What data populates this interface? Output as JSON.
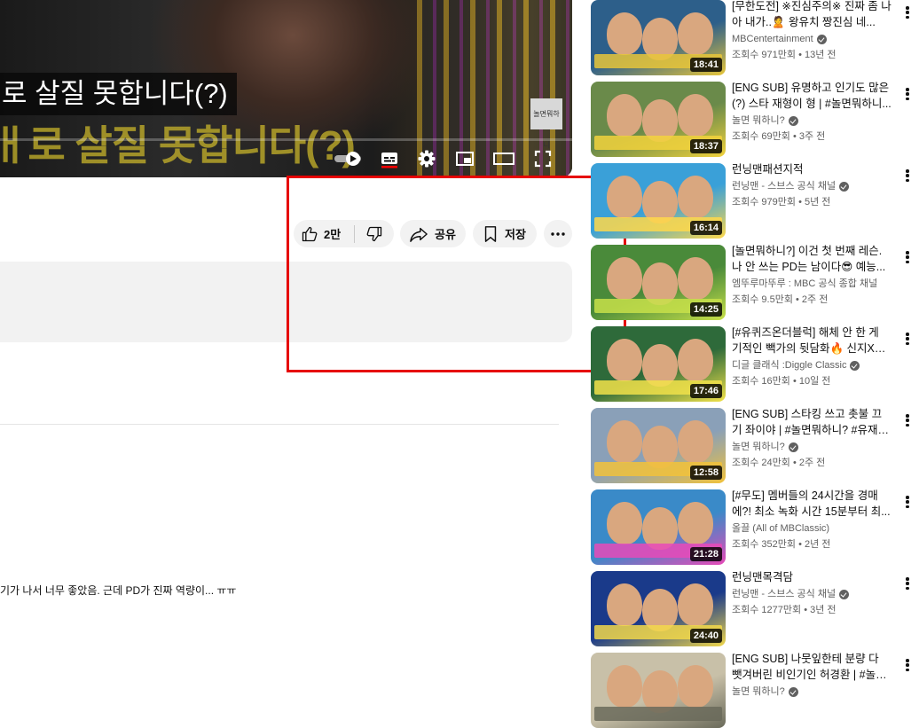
{
  "player": {
    "caption": "로 살질 못합니다(?)",
    "ghost_caption": "ㅐ로 살질 못합니다(?)",
    "watermark": "놀면뭐하니"
  },
  "actions": {
    "like_count": "2만",
    "share_label": "공유",
    "save_label": "저장"
  },
  "comment": {
    "text": "기가 나서 너무 좋았음. 근데 PD가 진짜 역량이... ㅠㅠ"
  },
  "recommendations": [
    {
      "title": "[무한도전] ※진심주의※ 진짜 좀 나아 내가..🙎 왕유치 짱진심 네...",
      "channel": "MBCentertainment",
      "verified": true,
      "views": "조회수 971만회",
      "age": "13년 전",
      "duration": "18:41",
      "thumb_colors": [
        "#2d5f8a",
        "#e8c63a"
      ]
    },
    {
      "title": "[ENG SUB] 유명하고 인기도 많은(?) 스타 재형이 형 | #놀면뭐하니...",
      "channel": "놀면 뭐하니?",
      "verified": true,
      "views": "조회수 69만회",
      "age": "3주 전",
      "duration": "18:37",
      "thumb_colors": [
        "#6a8a4a",
        "#f2d23c"
      ]
    },
    {
      "title": "런닝맨패션지적",
      "channel": "런닝맨 - 스브스 공식 채널",
      "verified": true,
      "views": "조회수 979만회",
      "age": "5년 전",
      "duration": "16:14",
      "thumb_colors": [
        "#3aa0d8",
        "#ffd84a"
      ]
    },
    {
      "title": "[놀면뭐하니?] 이건 첫 번째 레슨. 나 안 쓰는 PD는 남이다😎 예능...",
      "channel": "엠뚜루마뚜루 : MBC 공식 종합 채널",
      "verified": false,
      "views": "조회수 9.5만회",
      "age": "2주 전",
      "duration": "14:25",
      "thumb_colors": [
        "#4a8a3a",
        "#c8e04a"
      ]
    },
    {
      "title": "[#유퀴즈온더블럭] 해체 안 한 게 기적인 빽가의 뒷담화🔥 신지X종민...",
      "channel": "디글 클래식 :Diggle Classic",
      "verified": true,
      "views": "조회수 16만회",
      "age": "10일 전",
      "duration": "17:46",
      "thumb_colors": [
        "#2e6a3a",
        "#f2e24a"
      ]
    },
    {
      "title": "[ENG SUB] 스타킹 쓰고 촛불 끄기 좌이야 | #놀면뭐하니? #유재석 ...",
      "channel": "놀면 뭐하니?",
      "verified": true,
      "views": "조회수 24만회",
      "age": "2주 전",
      "duration": "12:58",
      "thumb_colors": [
        "#8aa0b8",
        "#f2c23a"
      ]
    },
    {
      "title": "[#무도] 멤버들의 24시간을 경매에?! 최소 녹화 시간 15분부터 최...",
      "channel": "올끌 (All of MBClassic)",
      "verified": false,
      "views": "조회수 352만회",
      "age": "2년 전",
      "duration": "21:28",
      "thumb_colors": [
        "#3a8ac8",
        "#e84ab8"
      ]
    },
    {
      "title": "런닝맨목격담",
      "channel": "런닝맨 - 스브스 공식 채널",
      "verified": true,
      "views": "조회수 1277만회",
      "age": "3년 전",
      "duration": "24:40",
      "thumb_colors": [
        "#1a3a8a",
        "#f2d84a"
      ]
    },
    {
      "title": "[ENG SUB] 나뭇잎한테 분량 다 뺏겨버린 비인기인 허경환 | #놀면...",
      "channel": "놀면 뭐하니?",
      "verified": true,
      "views": "",
      "age": "",
      "duration": "",
      "thumb_colors": [
        "#c8c0a8",
        "#6a6a5a"
      ]
    }
  ],
  "colors": {
    "highlight": "#e60000",
    "button_bg": "#f2f2f2",
    "secondary_text": "#606060"
  }
}
